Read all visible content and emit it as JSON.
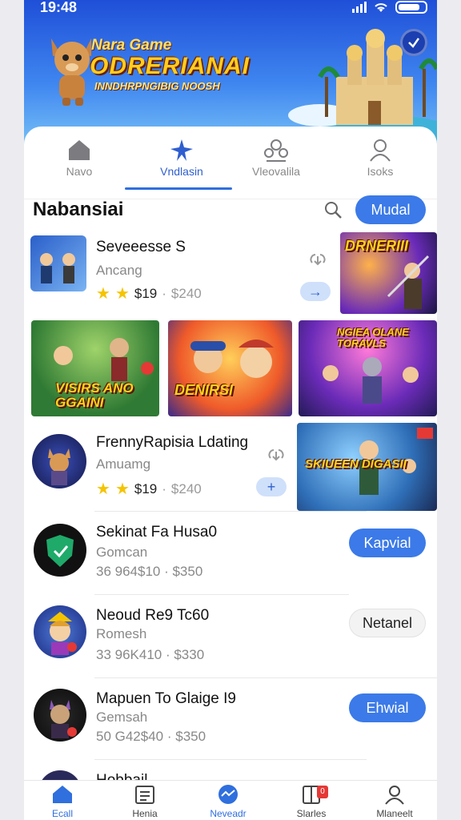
{
  "status": {
    "time": "19:48"
  },
  "hero": {
    "title_small": "Nara Game",
    "title_big": "ODRERIANAI",
    "subtitle": "INNDHRPNGIBIG NOOSH"
  },
  "tabs": [
    {
      "label": "Navo",
      "icon": "home-icon"
    },
    {
      "label": "Vndlasin",
      "icon": "star-burst-icon"
    },
    {
      "label": "Vleovalila",
      "icon": "people-icon"
    },
    {
      "label": "Isoks",
      "icon": "user-icon"
    }
  ],
  "section": {
    "title": "Nabansiai",
    "action": "Mudal"
  },
  "items": [
    {
      "name": "Seveeesse S",
      "sub": "Ancang",
      "price": "$19",
      "old_price": "$240",
      "stars": 2
    },
    {
      "name": "FrennyRapisia Ldating",
      "sub": "Amuamg",
      "price": "$19",
      "old_price": "$240",
      "stars": 2
    },
    {
      "name": "Sekinat Fa Husa0",
      "sub": "Gomcan",
      "price_line": "36 964$10 · $350",
      "action": "Kapvial"
    },
    {
      "name": "Neoud Re9 Tc60",
      "sub": "Romesh",
      "price_line": "33 96K410 · $330",
      "action": "Netanel"
    },
    {
      "name": "Mapuen To Glaige I9",
      "sub": "Gemsah",
      "price_line": "50 G42$40 · $350",
      "action": "Ehwial"
    },
    {
      "name": "Hobbail"
    }
  ],
  "artwork": {
    "card1": "DRNERIII",
    "tile1": "VISIRS ANO GGAINI",
    "tile2": "DENIRSI",
    "tile3": "NGIEA OLANE TORAVLS",
    "card2": "SKIUEEN DIGASII"
  },
  "small_add_labels": [
    "→",
    "+"
  ],
  "bottom_nav": [
    {
      "label": "Ecall",
      "icon": "home-icon"
    },
    {
      "label": "Henia",
      "icon": "calendar-icon"
    },
    {
      "label": "Neveadr",
      "icon": "activity-icon"
    },
    {
      "label": "Slarles",
      "icon": "book-icon",
      "badge": "0"
    },
    {
      "label": "Mlaneelt",
      "icon": "user-icon"
    }
  ],
  "colors": {
    "accent": "#3b7ae8",
    "hero_top": "#1f4fd8",
    "star": "#f5c400"
  }
}
